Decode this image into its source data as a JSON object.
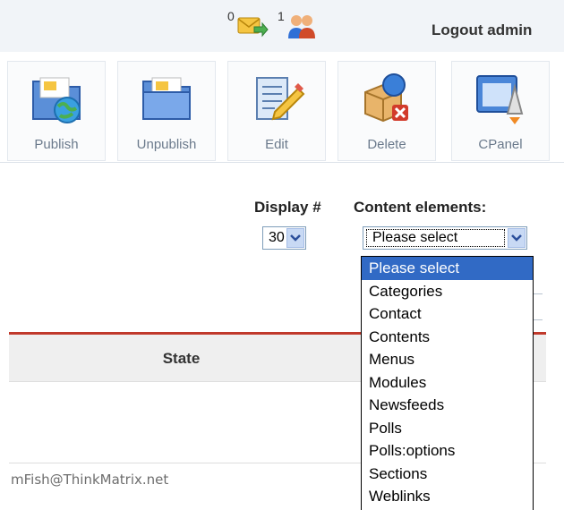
{
  "status": {
    "messages_count": "0",
    "users_count": "1",
    "logout_label": "Logout admin"
  },
  "toolbar": {
    "buttons": [
      {
        "label": "Publish",
        "icon": "publish-icon"
      },
      {
        "label": "Unpublish",
        "icon": "unpublish-icon"
      },
      {
        "label": "Edit",
        "icon": "edit-icon"
      },
      {
        "label": "Delete",
        "icon": "delete-icon"
      },
      {
        "label": "CPanel",
        "icon": "cpanel-icon"
      }
    ]
  },
  "filters": {
    "display_label": "Display #",
    "display_value": "30",
    "content_label": "Content elements:",
    "content_value": "Please select"
  },
  "dropdown": {
    "options": [
      "Please select",
      "Categories",
      "Contact",
      "Contents",
      "Menus",
      "Modules",
      "Newsfeeds",
      "Polls",
      "Polls:options",
      "Sections",
      "Weblinks"
    ],
    "selected_index": 0
  },
  "table": {
    "columns": [
      "State"
    ]
  },
  "footer": {
    "text": "mFish@ThinkMatrix.net"
  },
  "colors": {
    "accent_rule": "#c0392b",
    "selection": "#316ac5"
  }
}
